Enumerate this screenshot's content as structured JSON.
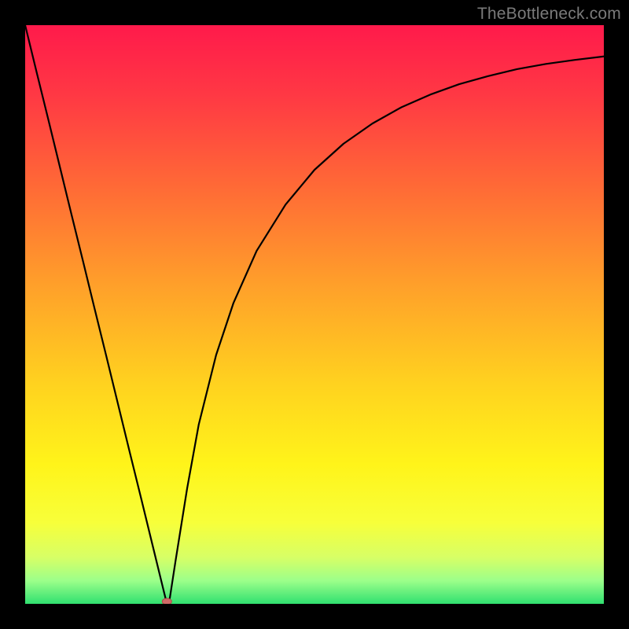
{
  "watermark": "TheBottleneck.com",
  "chart_data": {
    "type": "line",
    "title": "",
    "xlabel": "",
    "ylabel": "",
    "xlim": [
      0,
      1
    ],
    "ylim": [
      0,
      1
    ],
    "legend": false,
    "grid": false,
    "background_gradient_stops": [
      {
        "offset": 0.0,
        "color": "#ff1a4b"
      },
      {
        "offset": 0.12,
        "color": "#ff3844"
      },
      {
        "offset": 0.28,
        "color": "#ff6a36"
      },
      {
        "offset": 0.45,
        "color": "#ffa02a"
      },
      {
        "offset": 0.62,
        "color": "#ffd21f"
      },
      {
        "offset": 0.76,
        "color": "#fff41a"
      },
      {
        "offset": 0.86,
        "color": "#f7ff3a"
      },
      {
        "offset": 0.92,
        "color": "#d7ff66"
      },
      {
        "offset": 0.96,
        "color": "#9cff8a"
      },
      {
        "offset": 1.0,
        "color": "#30e070"
      }
    ],
    "series": [
      {
        "name": "curve",
        "x": [
          0.0,
          0.02,
          0.04,
          0.06,
          0.08,
          0.1,
          0.12,
          0.14,
          0.16,
          0.18,
          0.2,
          0.22,
          0.24,
          0.245,
          0.25,
          0.26,
          0.28,
          0.3,
          0.33,
          0.36,
          0.4,
          0.45,
          0.5,
          0.55,
          0.6,
          0.65,
          0.7,
          0.75,
          0.8,
          0.85,
          0.9,
          0.95,
          1.0
        ],
        "y": [
          1.0,
          0.918,
          0.837,
          0.755,
          0.673,
          0.592,
          0.51,
          0.429,
          0.347,
          0.265,
          0.184,
          0.102,
          0.02,
          0.0,
          0.01,
          0.075,
          0.2,
          0.31,
          0.43,
          0.52,
          0.61,
          0.69,
          0.75,
          0.795,
          0.83,
          0.858,
          0.88,
          0.898,
          0.912,
          0.924,
          0.933,
          0.94,
          0.946
        ]
      }
    ],
    "cusp_marker": {
      "x": 0.245,
      "y": 0.0
    }
  }
}
